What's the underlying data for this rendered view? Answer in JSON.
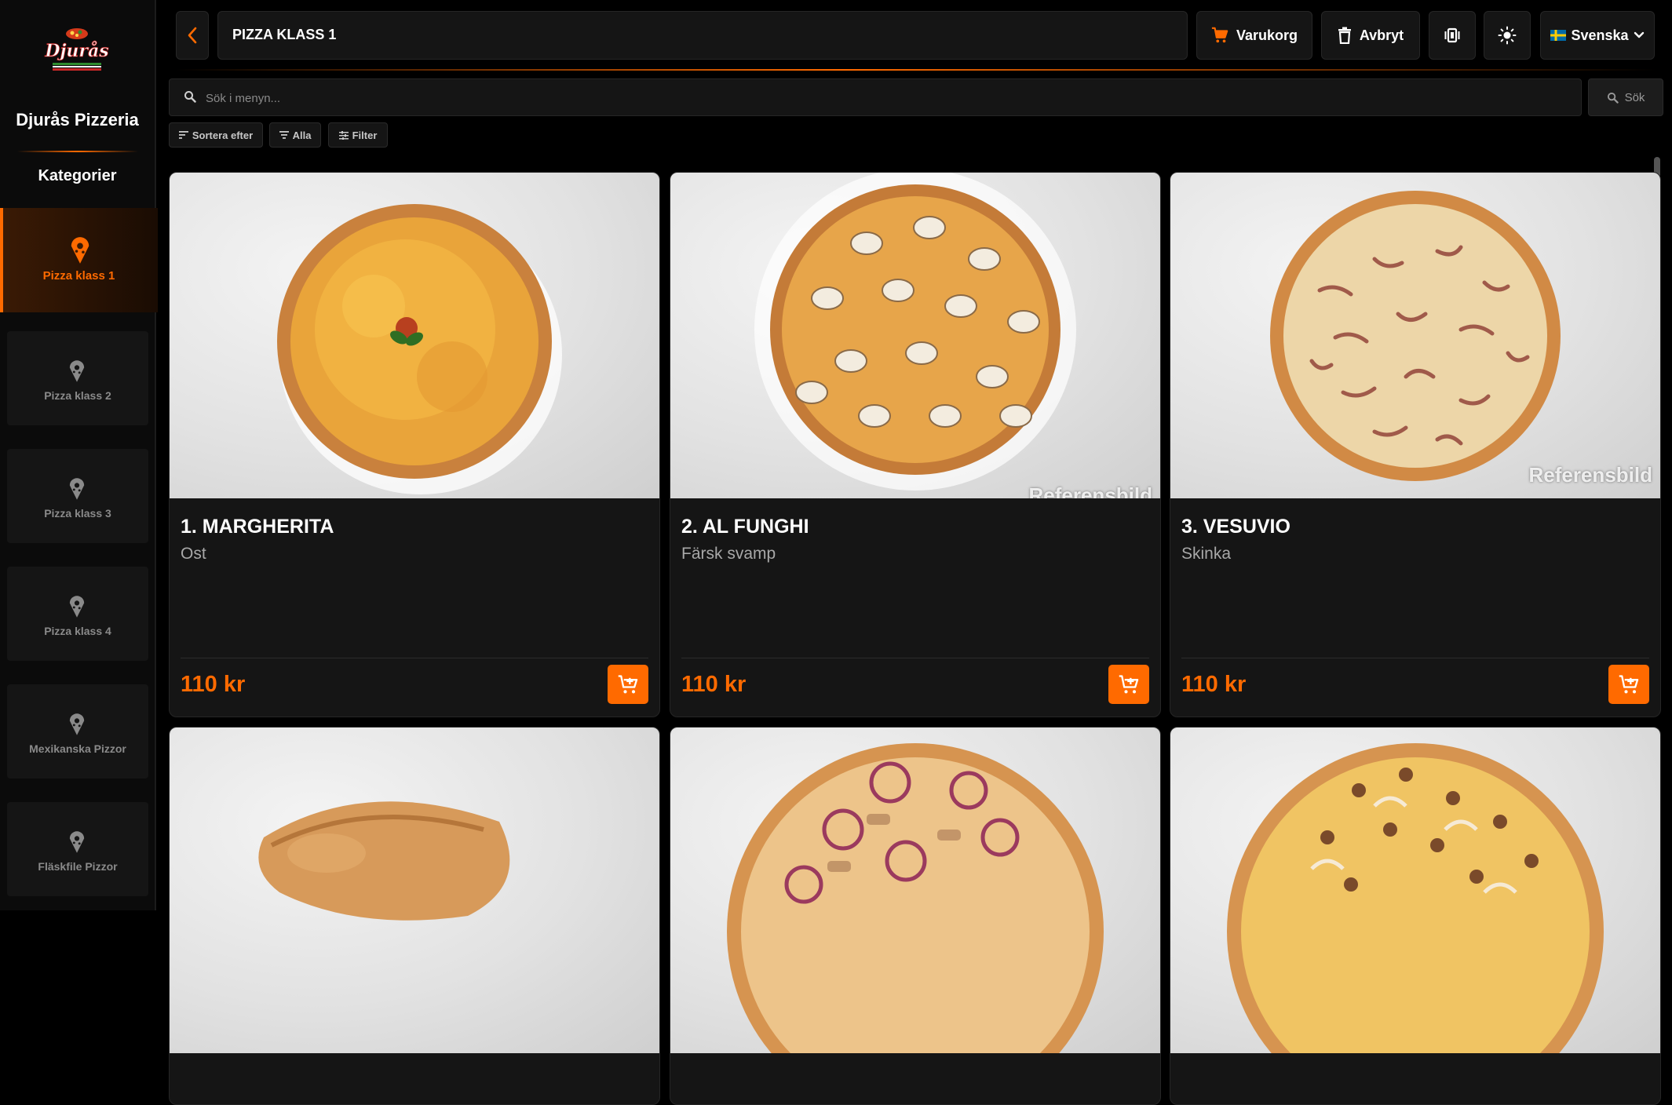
{
  "brand": {
    "name": "Djurås Pizzeria",
    "logo_text": "Djurås",
    "logo_icon": "pizza-logo"
  },
  "sidebar": {
    "title": "Kategorier",
    "items": [
      {
        "label": "Pizza klass 1",
        "active": true,
        "icon": "pizza-slice-pin-icon"
      },
      {
        "label": "Pizza klass 2",
        "active": false,
        "icon": "pizza-slice-pin-icon"
      },
      {
        "label": "Pizza klass 3",
        "active": false,
        "icon": "pizza-slice-pin-icon"
      },
      {
        "label": "Pizza klass 4",
        "active": false,
        "icon": "pizza-slice-pin-icon"
      },
      {
        "label": "Mexikanska Pizzor",
        "active": false,
        "icon": "pizza-slice-pin-icon"
      },
      {
        "label": "Fläskfile Pizzor",
        "active": false,
        "icon": "pizza-slice-pin-icon"
      }
    ]
  },
  "header": {
    "title": "PIZZA KLASS 1",
    "cart_label": "Varukorg",
    "cancel_label": "Avbryt",
    "language_label": "Svenska",
    "icons": [
      "chevron-left-icon",
      "cart-icon",
      "trash-icon",
      "vibrate-icon",
      "sun-icon",
      "swedish-flag-icon",
      "chevron-down-icon"
    ]
  },
  "search": {
    "placeholder": "Sök i menyn...",
    "button_label": "Sök"
  },
  "filters": {
    "sort_label": "Sortera efter",
    "all_label": "Alla",
    "filter_label": "Filter"
  },
  "products": [
    {
      "name": "1. MARGHERITA",
      "description": "Ost",
      "price": "110 kr",
      "watermark": ""
    },
    {
      "name": "2. AL FUNGHI",
      "description": "Färsk svamp",
      "price": "110 kr",
      "watermark": "Referensbild"
    },
    {
      "name": "3. VESUVIO",
      "description": "Skinka",
      "price": "110 kr",
      "watermark": "Referensbild"
    }
  ],
  "colors": {
    "accent": "#ff6a00",
    "background": "#000000",
    "surface": "#151515",
    "muted_text": "#a8a8a8"
  }
}
